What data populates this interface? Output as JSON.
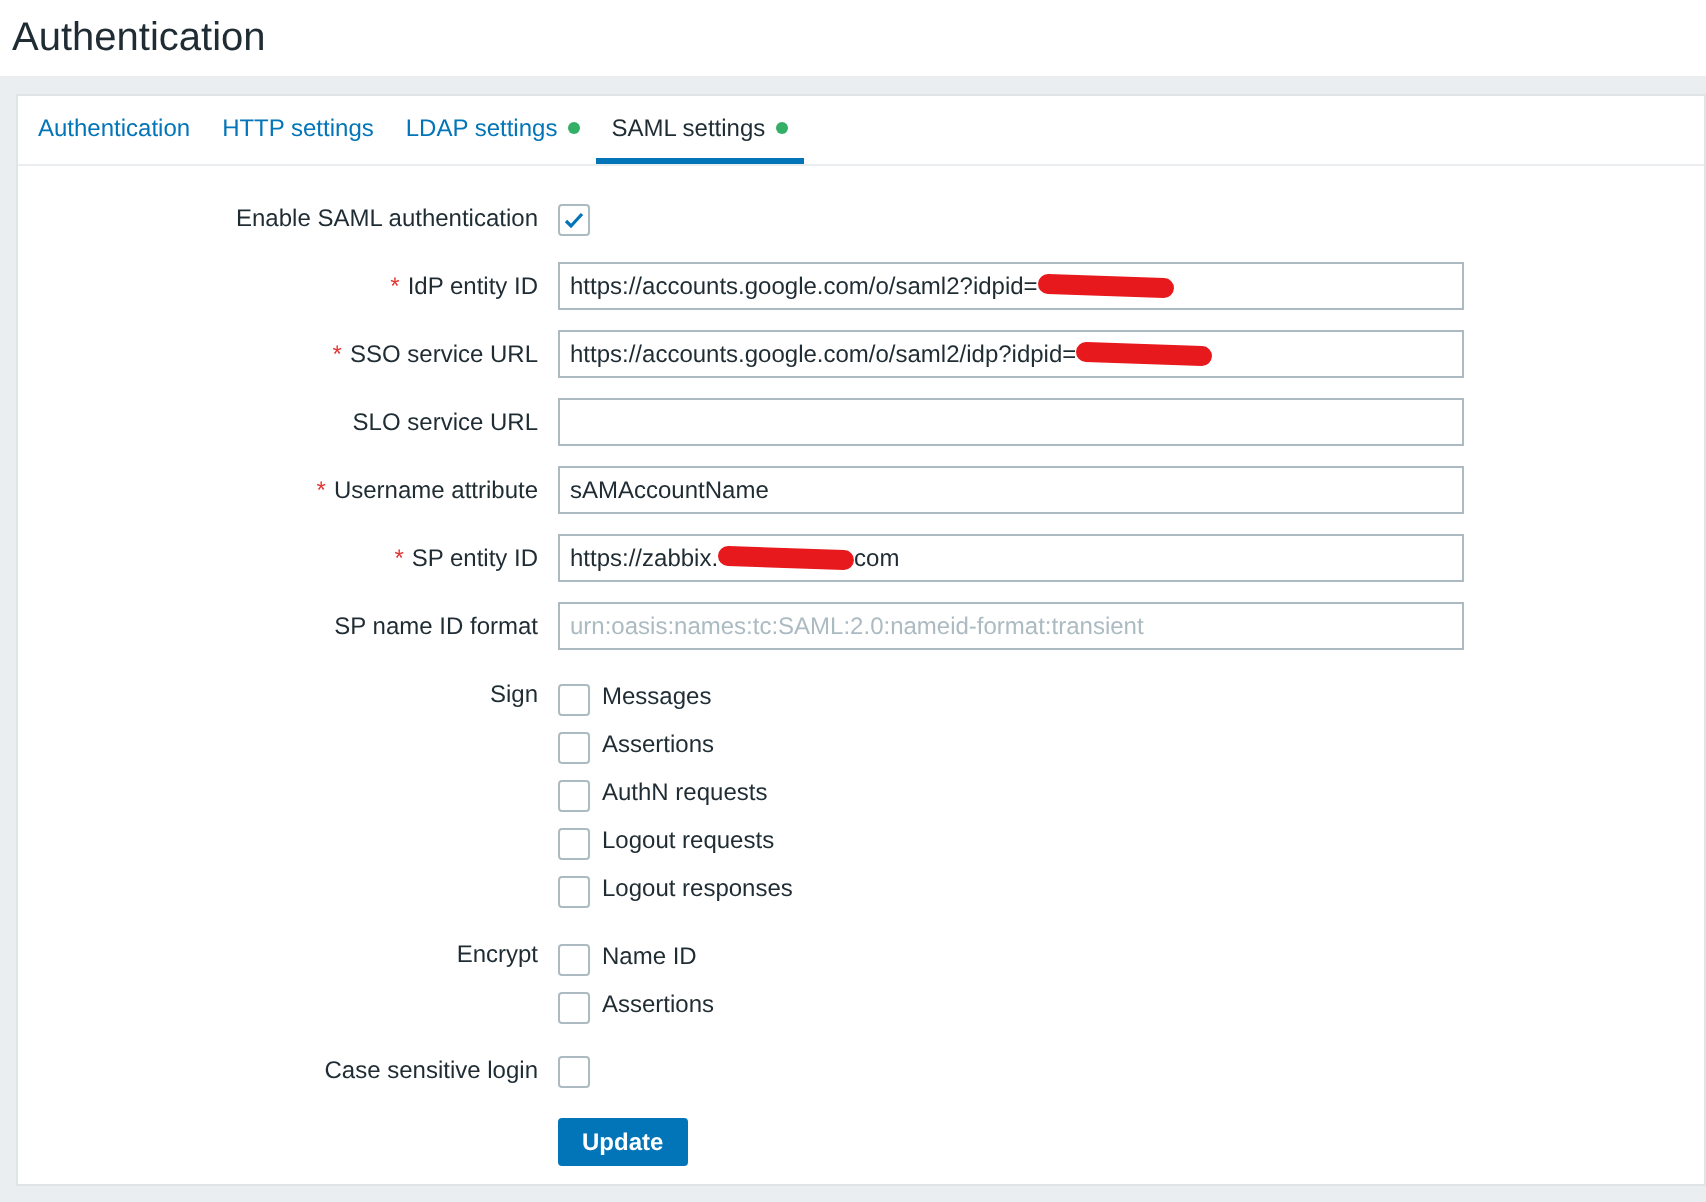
{
  "page_title": "Authentication",
  "tabs": [
    {
      "label": "Authentication",
      "selected": false,
      "status_dot": false
    },
    {
      "label": "HTTP settings",
      "selected": false,
      "status_dot": false
    },
    {
      "label": "LDAP settings",
      "selected": false,
      "status_dot": true
    },
    {
      "label": "SAML settings",
      "selected": true,
      "status_dot": true
    }
  ],
  "rows": [
    {
      "kind": "checkbox",
      "label": "Enable SAML authentication",
      "checked": true
    },
    {
      "kind": "field",
      "label": "IdP entity ID",
      "required_mark": "*",
      "value": "https://accounts.google.com/o/saml2?idpid=",
      "redacted": true
    },
    {
      "kind": "field",
      "label": "SSO service URL",
      "required_mark": "*",
      "value": "https://accounts.google.com/o/saml2/idp?idpid=",
      "redacted": true
    },
    {
      "kind": "field",
      "label": "SLO service URL"
    },
    {
      "kind": "field",
      "label": "Username attribute",
      "required_mark": "*",
      "value": "sAMAccountName"
    },
    {
      "kind": "field",
      "label": "SP entity ID",
      "required_mark": "*",
      "value": "https://zabbix.",
      "redacted": true,
      "value_end": "com"
    },
    {
      "kind": "field",
      "label": "SP name ID format",
      "placeholder": "urn:oasis:names:tc:SAML:2.0:nameid-format:transient"
    },
    {
      "kind": "options",
      "label": "Sign",
      "options": [
        {
          "label": "Messages",
          "checked": false
        },
        {
          "label": "Assertions",
          "checked": false
        },
        {
          "label": "AuthN requests",
          "checked": false
        },
        {
          "label": "Logout requests",
          "checked": false
        },
        {
          "label": "Logout responses",
          "checked": false
        }
      ]
    },
    {
      "kind": "options",
      "label": "Encrypt",
      "options": [
        {
          "label": "Name ID",
          "checked": false
        },
        {
          "label": "Assertions",
          "checked": false
        }
      ]
    },
    {
      "kind": "checkbox",
      "label": "Case sensitive login",
      "checked": false
    }
  ],
  "button": "Update"
}
